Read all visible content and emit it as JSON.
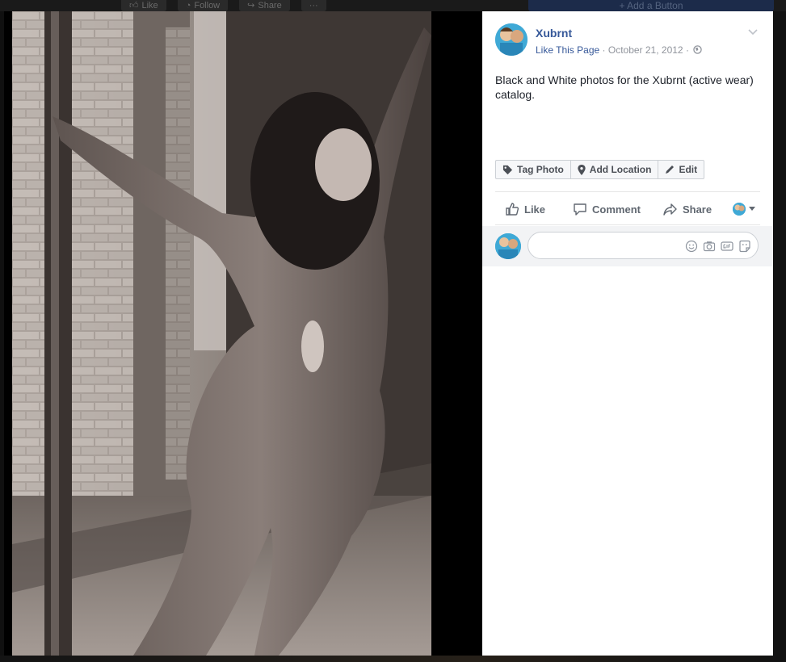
{
  "background": {
    "actions": [
      {
        "icon": "thumbs-up-icon",
        "label": "Like"
      },
      {
        "icon": "rss-icon",
        "label": "Follow"
      },
      {
        "icon": "share-icon",
        "label": "Share"
      },
      {
        "icon": "more-icon",
        "label": "···"
      }
    ],
    "add_button_label": "+ Add a Button"
  },
  "post": {
    "page_name": "Xubrnt",
    "like_page_link": "Like This Page",
    "separator": "·",
    "date": "October 21, 2012",
    "privacy_icon": "globe-icon",
    "caption": "Black and White photos for the Xubrnt (active wear) catalog."
  },
  "photo_tools": [
    {
      "icon": "tag-icon",
      "label": "Tag Photo"
    },
    {
      "icon": "location-pin-icon",
      "label": "Add Location"
    },
    {
      "icon": "pencil-icon",
      "label": "Edit"
    }
  ],
  "actions": {
    "like": "Like",
    "comment": "Comment",
    "share": "Share"
  },
  "colors": {
    "link": "#365899",
    "meta": "#90949c",
    "text": "#1d2129",
    "action": "#606770"
  }
}
